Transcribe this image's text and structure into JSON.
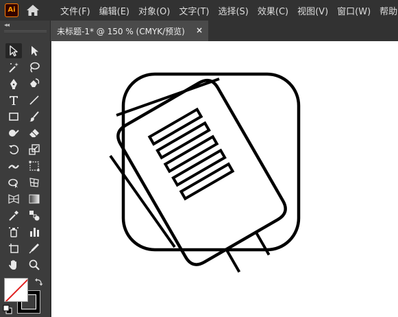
{
  "app": {
    "logo_text": "Ai",
    "accent": "#ff9a00"
  },
  "menu": {
    "items": [
      "文件(F)",
      "编辑(E)",
      "对象(O)",
      "文字(T)",
      "选择(S)",
      "效果(C)",
      "视图(V)",
      "窗口(W)",
      "帮助(H)"
    ]
  },
  "document": {
    "tab_title": "未标题-1* @ 150 % (CMYK/预览)",
    "close_glyph": "×"
  },
  "toolbar": {
    "collapse_glyph": "◂◂",
    "tools": [
      "selection-tool",
      "direct-selection-tool",
      "magic-wand-tool",
      "lasso-tool",
      "pen-tool",
      "curvature-tool",
      "type-tool",
      "line-segment-tool",
      "rectangle-tool",
      "paintbrush-tool",
      "shaper-tool",
      "eraser-tool",
      "rotate-tool",
      "scale-tool",
      "width-tool",
      "free-transform-tool",
      "shape-builder-tool",
      "gradient-mesh-tool",
      "perspective-grid-tool",
      "gradient-tool",
      "eyedropper-tool",
      "blend-tool",
      "symbol-sprayer-tool",
      "column-graph-tool",
      "artboard-tool",
      "slice-tool",
      "hand-tool",
      "zoom-tool"
    ],
    "active_tool": "selection-tool",
    "fill_color": "#ffffff",
    "stroke_color": "#000000"
  }
}
